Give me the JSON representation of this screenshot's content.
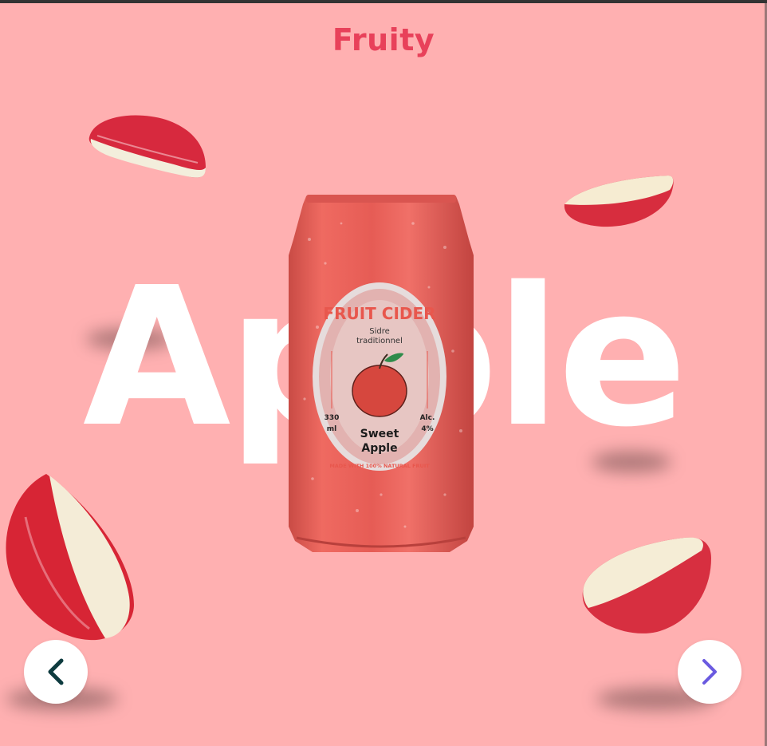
{
  "brand": {
    "title": "Fruity",
    "color": "#e8415a"
  },
  "hero": {
    "word": "Apple"
  },
  "product": {
    "label_arc_top": "FRUIT CIDER",
    "subtitle_line1": "Sidre",
    "subtitle_line2": "traditionnel",
    "volume_line1": "330",
    "volume_line2": "ml",
    "alc_line1": "Alc.",
    "alc_line2": "4%",
    "name_line1": "Sweet",
    "name_line2": "Apple",
    "label_arc_bottom": "MADE WITH 100% NATURAL FRUIT"
  },
  "navigation": {
    "prev_icon": "chevron-left-icon",
    "next_icon": "chevron-right-icon"
  },
  "colors": {
    "background": "#ffb0b1",
    "can": "#e8605a",
    "prev_arrow": "#0e3b3f",
    "next_arrow": "#6a5ae0"
  }
}
